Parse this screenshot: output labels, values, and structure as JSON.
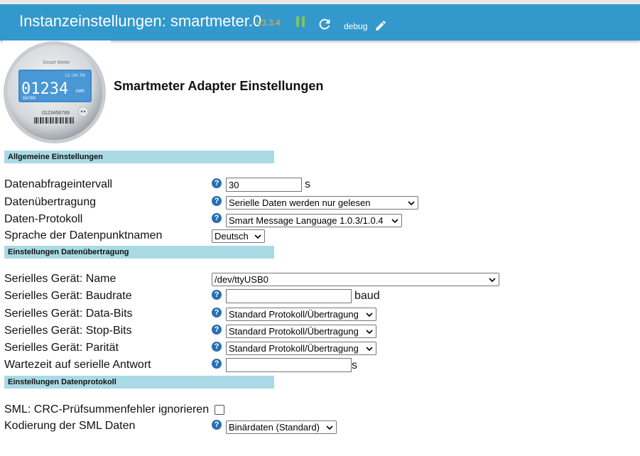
{
  "header": {
    "title": "Instanzeinstellungen: smartmeter.0",
    "version": "v3.3.4",
    "log_level": "debug",
    "icons": {
      "pause": "pause-icon",
      "reload": "reload-icon",
      "edit": "edit-pencil-icon"
    },
    "colors": {
      "bar": "#3399cc",
      "version": "#e8b64c",
      "pause": "#7cc36a"
    }
  },
  "logo": {
    "brand": "Smart Meter",
    "time": "12:34:56",
    "reading": "01234",
    "unit": "kWh",
    "sub_reading": "56789",
    "serial": "0123456789"
  },
  "page_heading": "Smartmeter Adapter Einstellungen",
  "sections": {
    "general": "Allgemeine Einstellungen",
    "transfer": "Einstellungen Datenübertragung",
    "protocol": "Einstellungen Datenprotokoll"
  },
  "general": {
    "interval_label": "Datenabfrageintervall",
    "interval_value": "30",
    "interval_unit": "s",
    "transfer_label": "Datenübertragung",
    "transfer_value": "Serielle Daten werden nur gelesen",
    "protocol_label": "Daten-Protokoll",
    "protocol_value": "Smart Message Language 1.0.3/1.0.4",
    "language_label": "Sprache der Datenpunktnamen",
    "language_value": "Deutsch"
  },
  "transfer": {
    "device_label": "Serielles Gerät: Name",
    "device_value": "/dev/ttyUSB0",
    "baud_label": "Serielles Gerät: Baudrate",
    "baud_value": "",
    "baud_unit": "baud",
    "databits_label": "Serielles Gerät: Data-Bits",
    "databits_value": "Standard Protokoll/Übertragung",
    "stopbits_label": "Serielles Gerät: Stop-Bits",
    "stopbits_value": "Standard Protokoll/Übertragung",
    "parity_label": "Serielles Gerät: Parität",
    "parity_value": "Standard Protokoll/Übertragung",
    "wait_label": "Wartezeit auf serielle Antwort",
    "wait_value": "",
    "wait_unit": "s"
  },
  "protocol": {
    "crc_label": "SML: CRC-Prüfsummenfehler ignorieren",
    "crc_checked": false,
    "encoding_label": "Kodierung der SML Daten",
    "encoding_value": "Binärdaten (Standard)"
  },
  "help_glyph": "?"
}
